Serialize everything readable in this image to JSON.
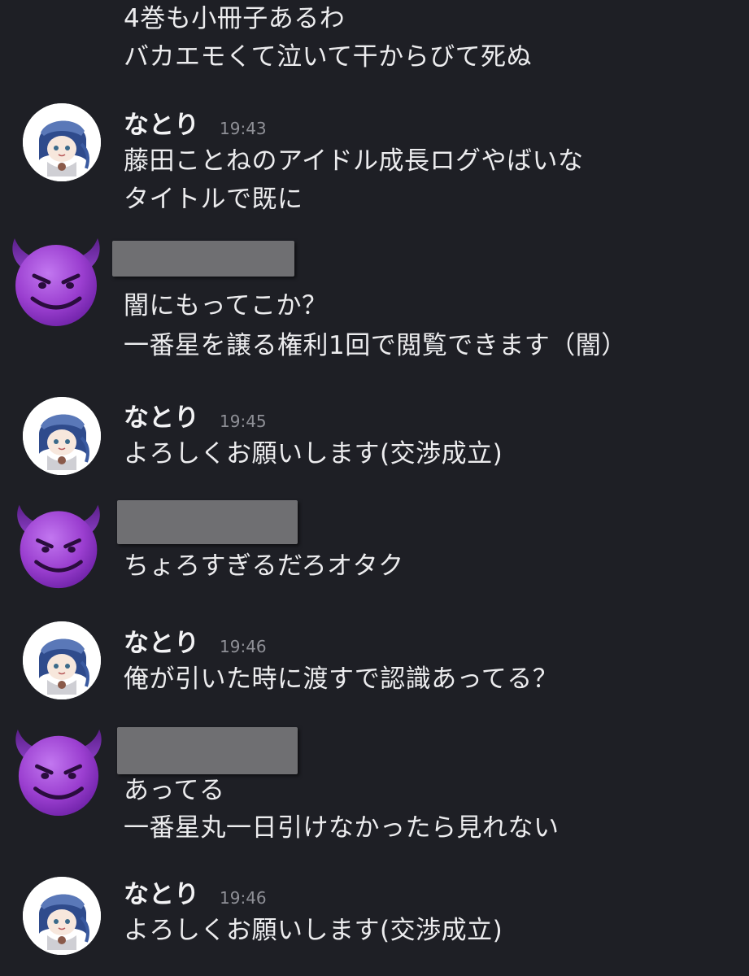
{
  "messages": [
    {
      "type": "continuation",
      "lines": [
        "4巻も小冊子あるわ",
        "バカエモくて泣いて干からびて死ぬ"
      ]
    },
    {
      "type": "message",
      "author": "なとり",
      "time": "19:43",
      "avatar_icon": "user-avatar-illustration",
      "lines": [
        "藤田ことねのアイドル成長ログやばいな",
        "タイトルで既に"
      ]
    },
    {
      "type": "message",
      "author": "",
      "author_redacted": true,
      "avatar_icon": "smiling-devil-emoji-icon",
      "lines": [
        "闇にもってこか？",
        "一番星を譲る権利1回で閲覧できます（闇）"
      ]
    },
    {
      "type": "message",
      "author": "なとり",
      "time": "19:45",
      "avatar_icon": "user-avatar-illustration",
      "lines": [
        "よろしくお願いします(交渉成立)"
      ]
    },
    {
      "type": "message",
      "author": "",
      "author_redacted": true,
      "avatar_icon": "smiling-devil-emoji-icon",
      "lines": [
        "ちょろすぎるだろオタク"
      ]
    },
    {
      "type": "message",
      "author": "なとり",
      "time": "19:46",
      "avatar_icon": "user-avatar-illustration",
      "lines": [
        "俺が引いた時に渡すで認識あってる？"
      ]
    },
    {
      "type": "message",
      "author": "",
      "author_redacted": true,
      "avatar_icon": "smiling-devil-emoji-icon",
      "lines": [
        "あってる",
        "一番星丸一日引けなかったら見れない"
      ]
    },
    {
      "type": "message",
      "author": "なとり",
      "time": "19:46",
      "avatar_icon": "user-avatar-illustration",
      "lines": [
        "よろしくお願いします(交渉成立)"
      ]
    }
  ],
  "colors": {
    "background": "#1e1f25",
    "text": "#ececee",
    "timestamp": "#8f9097",
    "redaction": "#6f6f72",
    "devil": "#9b3fd0"
  }
}
